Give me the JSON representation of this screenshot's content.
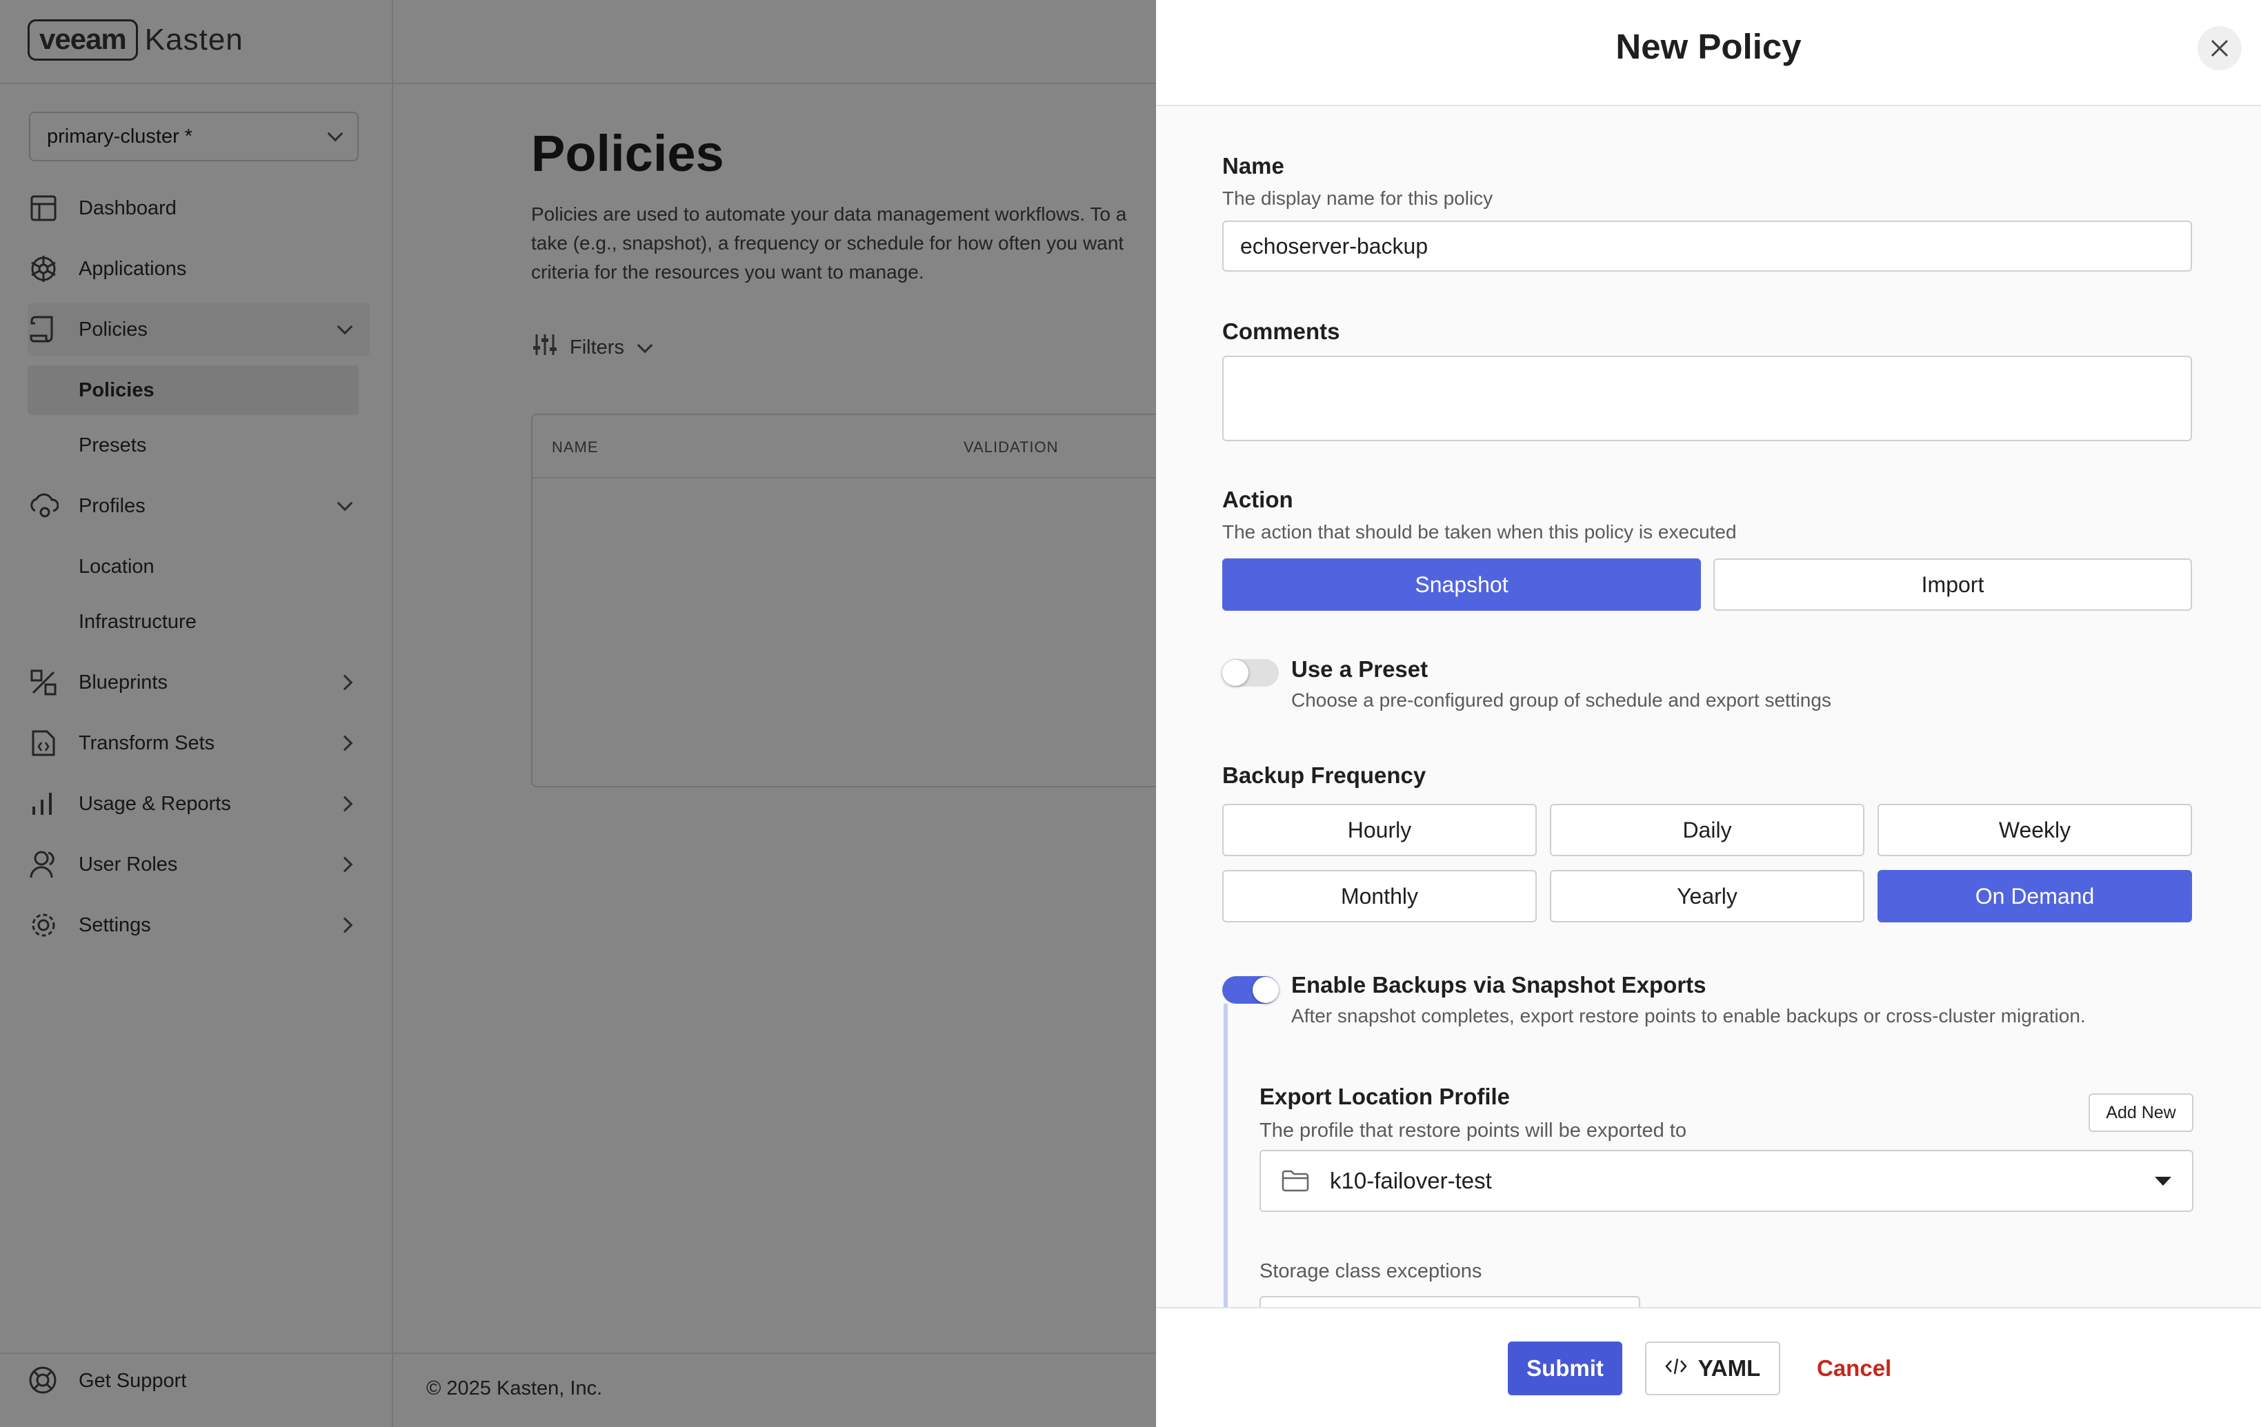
{
  "brand": {
    "logo_box": "veeam",
    "logo_text": "Kasten"
  },
  "cluster_selector": {
    "value": "primary-cluster *"
  },
  "sidebar": {
    "items": [
      {
        "label": "Dashboard",
        "icon": "dashboard-icon"
      },
      {
        "label": "Applications",
        "icon": "applications-icon"
      },
      {
        "label": "Policies",
        "icon": "policies-icon",
        "expanded": true
      },
      {
        "label": "Profiles",
        "icon": "profiles-icon",
        "expanded": true
      },
      {
        "label": "Blueprints",
        "icon": "blueprints-icon"
      },
      {
        "label": "Transform Sets",
        "icon": "transform-sets-icon"
      },
      {
        "label": "Usage & Reports",
        "icon": "usage-reports-icon"
      },
      {
        "label": "User Roles",
        "icon": "user-roles-icon"
      },
      {
        "label": "Settings",
        "icon": "settings-icon"
      }
    ],
    "policies_sub": [
      "Policies",
      "Presets"
    ],
    "profiles_sub": [
      "Location",
      "Infrastructure"
    ],
    "support_label": "Get Support"
  },
  "footer": {
    "copyright": "© 2025 Kasten, Inc."
  },
  "main": {
    "title": "Policies",
    "description_lines": [
      "Policies are used to automate your data management workflows. To a",
      "take (e.g., snapshot), a frequency or schedule for how often you want",
      "criteria for the resources you want to manage."
    ],
    "filters_label": "Filters",
    "table_headers": [
      "NAME",
      "VALIDATION"
    ]
  },
  "drawer": {
    "title": "New Policy",
    "name": {
      "label": "Name",
      "help": "The display name for this policy",
      "value": "echoserver-backup"
    },
    "comments": {
      "label": "Comments",
      "value": ""
    },
    "action": {
      "label": "Action",
      "help": "The action that should be taken when this policy is executed",
      "options": [
        "Snapshot",
        "Import"
      ],
      "selected": "Snapshot"
    },
    "preset": {
      "label": "Use a Preset",
      "help": "Choose a pre-configured group of schedule and export settings",
      "enabled": false
    },
    "frequency": {
      "label": "Backup Frequency",
      "options": [
        "Hourly",
        "Daily",
        "Weekly",
        "Monthly",
        "Yearly",
        "On Demand"
      ],
      "selected": "On Demand"
    },
    "exports": {
      "label": "Enable Backups via Snapshot Exports",
      "help": "After snapshot completes, export restore points to enable backups or cross-cluster migration.",
      "enabled": true
    },
    "export_profile": {
      "label": "Export Location Profile",
      "help": "The profile that restore points will be exported to",
      "add_new_label": "Add New",
      "value": "k10-failover-test"
    },
    "storage_exceptions_label": "Storage class exceptions",
    "buttons": {
      "submit": "Submit",
      "yaml": "YAML",
      "cancel": "Cancel"
    }
  },
  "colors": {
    "accent": "#5164e0",
    "cancel": "#c7261b",
    "overlay": "rgba(0,0,0,0.48)"
  }
}
